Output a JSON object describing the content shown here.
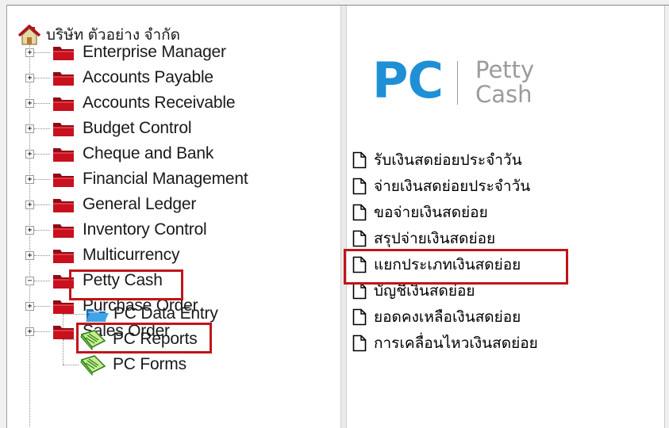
{
  "tree": {
    "root_label": "บริษัท ตัวอย่าง จำกัด",
    "modules": [
      {
        "label": "Enterprise Manager",
        "expander": "+"
      },
      {
        "label": "Accounts Payable",
        "expander": "+"
      },
      {
        "label": "Accounts Receivable",
        "expander": "+"
      },
      {
        "label": "Budget Control",
        "expander": "+"
      },
      {
        "label": "Cheque and Bank",
        "expander": "+"
      },
      {
        "label": "Financial Management",
        "expander": "+"
      },
      {
        "label": "General Ledger",
        "expander": "+"
      },
      {
        "label": "Inventory Control",
        "expander": "+"
      },
      {
        "label": "Multicurrency",
        "expander": "+"
      },
      {
        "label": "Petty Cash",
        "expander": "−"
      },
      {
        "label": "Purchase Order",
        "expander": "+"
      },
      {
        "label": "Sales Order",
        "expander": "+"
      }
    ],
    "petty_cash_children": [
      {
        "label": "PC Data Entry",
        "icon": "blue-folder-icon"
      },
      {
        "label": "PC Reports",
        "icon": "report-icon"
      },
      {
        "label": "PC Forms",
        "icon": "report-icon"
      }
    ]
  },
  "header": {
    "logo_text": "PC",
    "logo_sub_line1": "Petty",
    "logo_sub_line2": "Cash"
  },
  "reports": [
    "รับเงินสดย่อยประจำวัน",
    "จ่ายเงินสดย่อยประจำวัน",
    "ขอจ่ายเงินสดย่อย",
    "สรุปจ่ายเงินสดย่อย",
    "แยกประเภทเงินสดย่อย",
    "บัญชีเงินสดย่อย",
    "ยอดคงเหลือเงินสดย่อย",
    "การเคลื่อนไหวเงินสดย่อย"
  ],
  "colors": {
    "highlight": "#c0151b",
    "logo_blue": "#1f8fd6",
    "folder_red": "#c8101e"
  }
}
